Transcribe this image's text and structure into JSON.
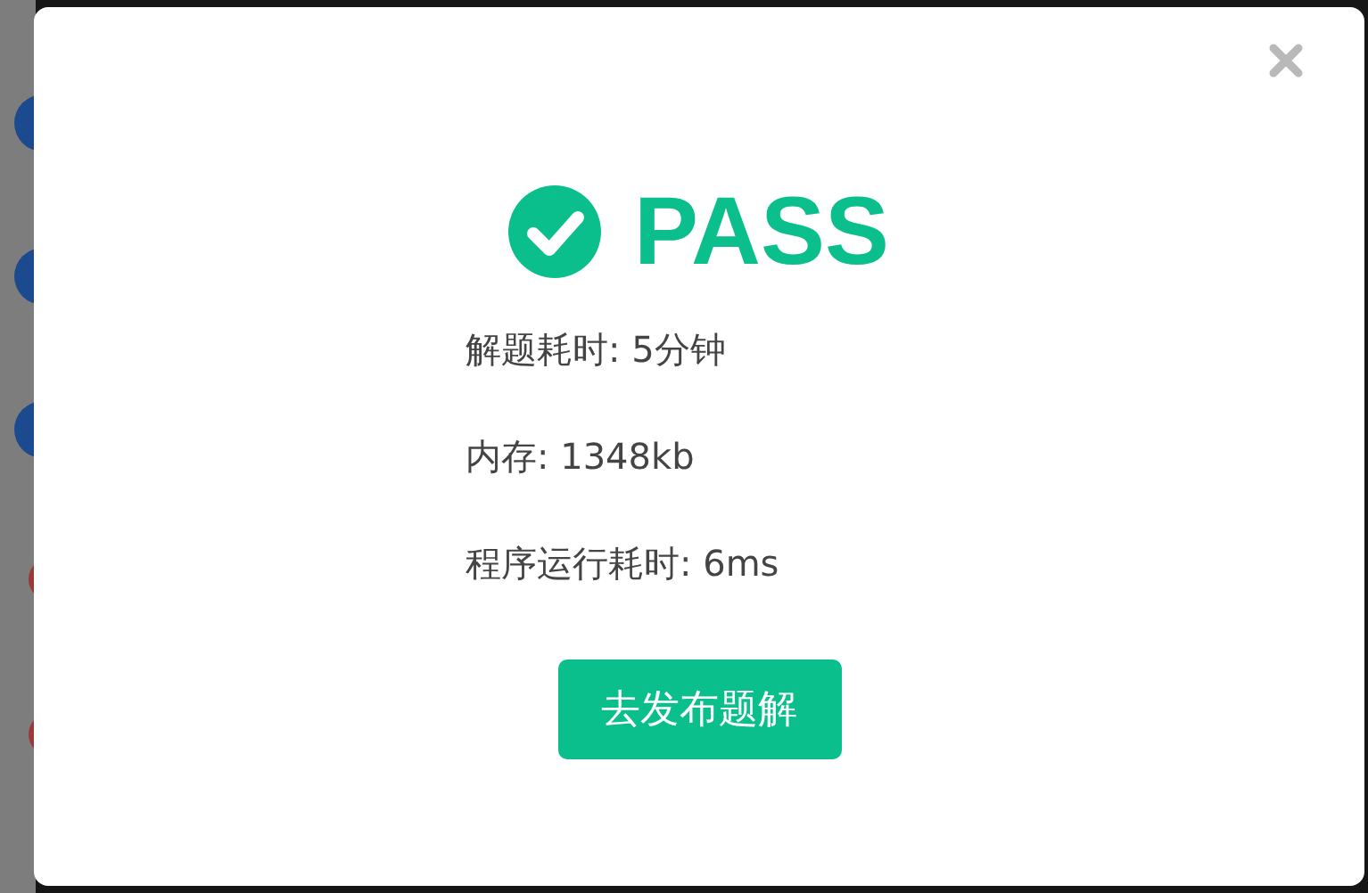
{
  "result": {
    "kind": "pass",
    "title": "PASS"
  },
  "stats": [
    "解题耗时: 5分钟",
    "内存: 1348kb",
    "程序运行耗时: 6ms"
  ],
  "button": "去发布题解"
}
